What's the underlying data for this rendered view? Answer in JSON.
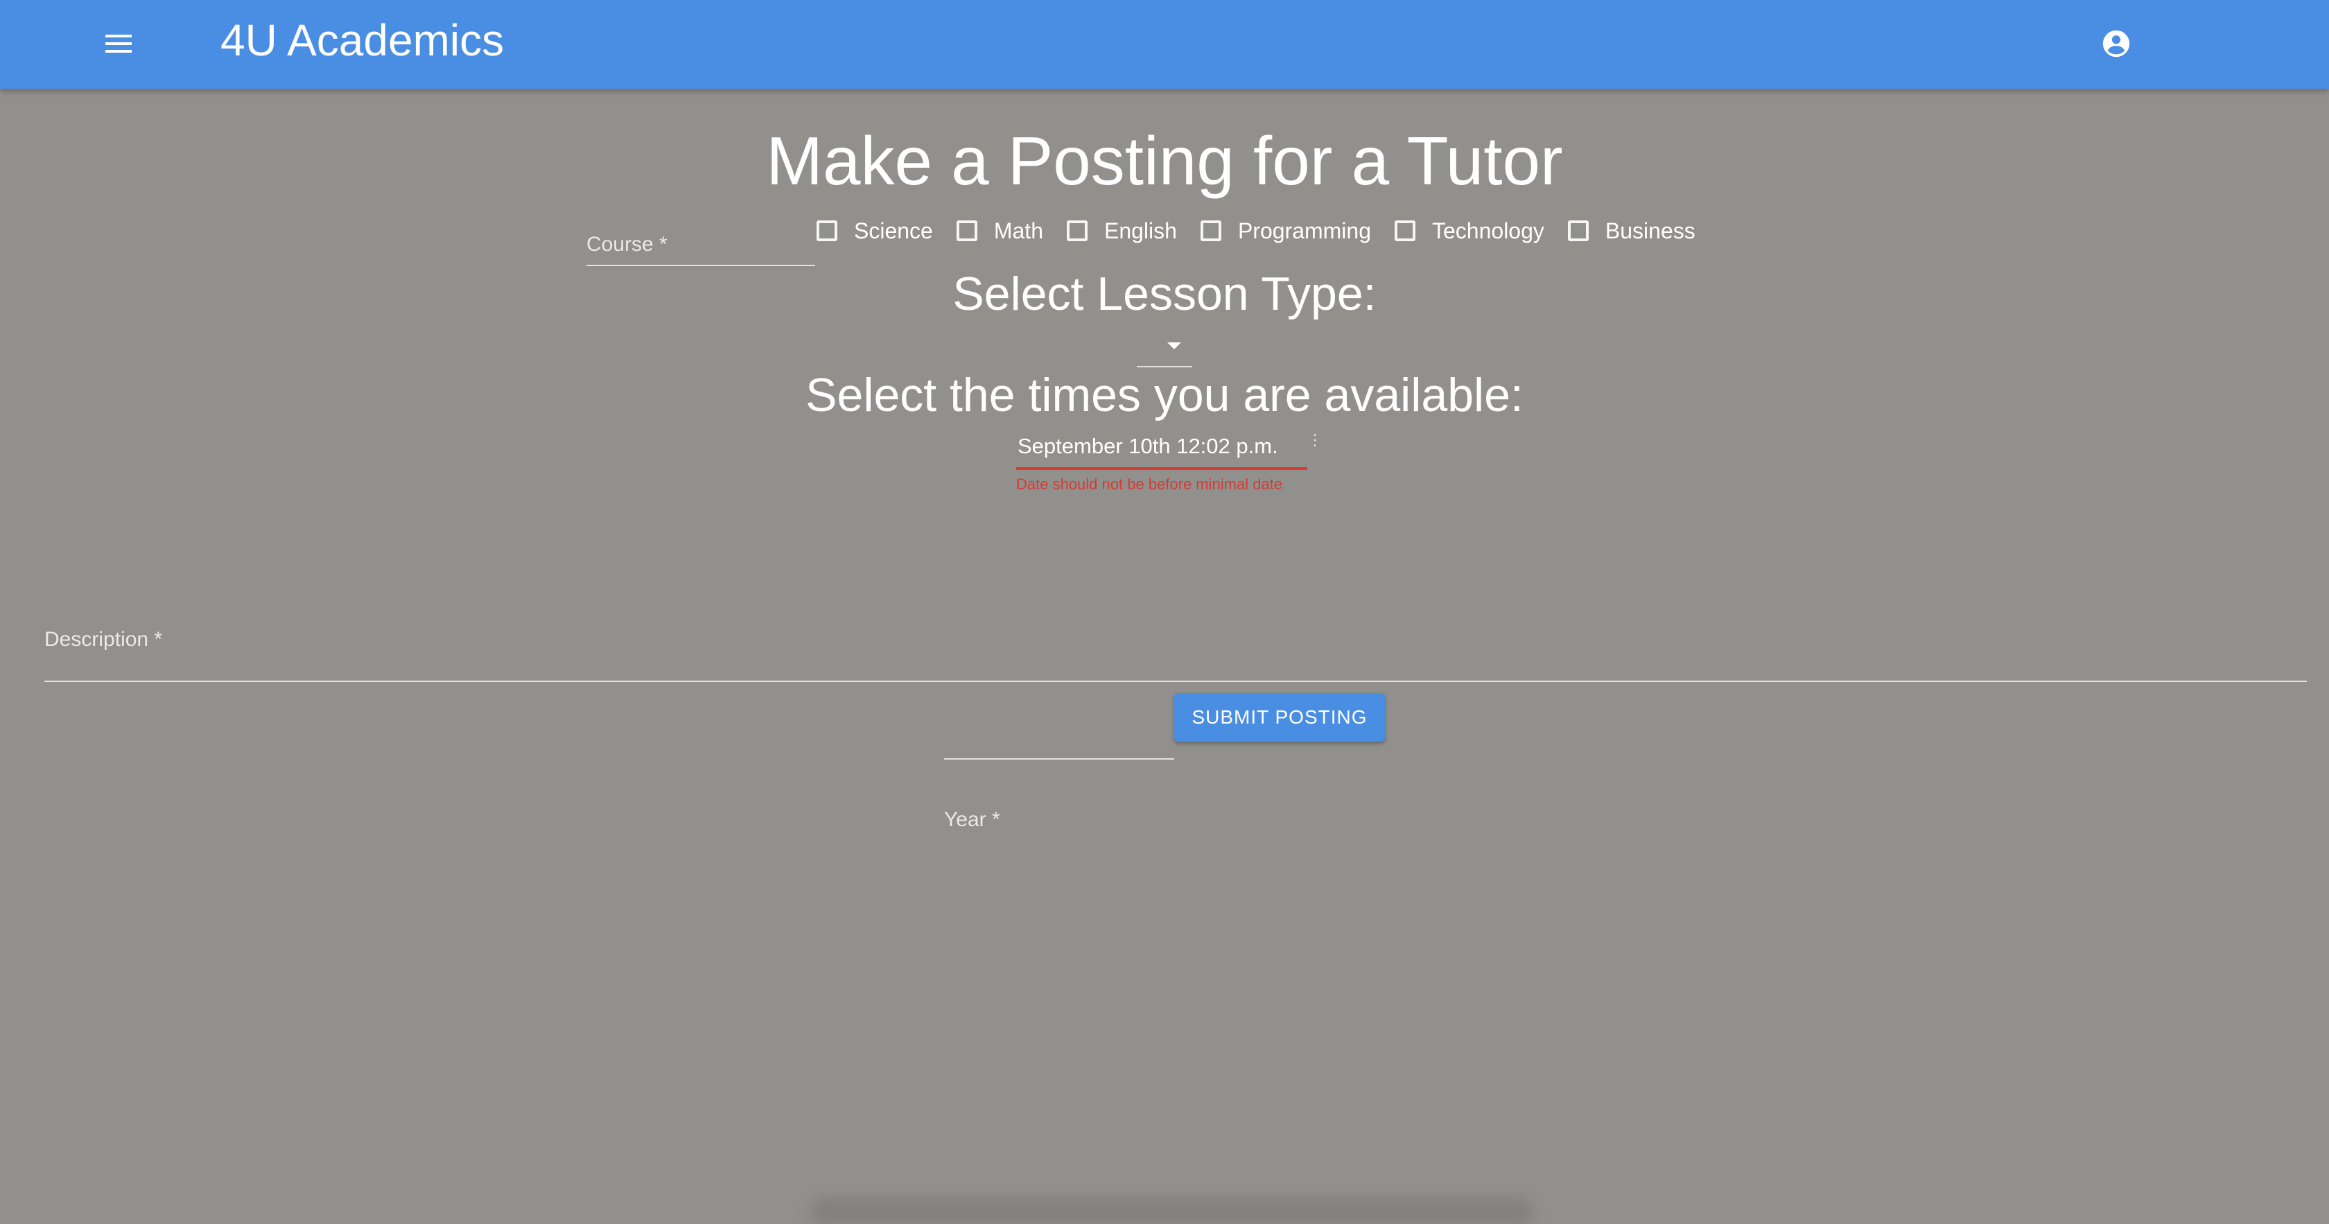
{
  "header": {
    "app_title": "4U Academics",
    "menu_icon": "hamburger-menu-icon",
    "account_icon": "account-circle-icon"
  },
  "form": {
    "title": "Make a Posting for a Tutor",
    "course": {
      "label": "Course *",
      "value": ""
    },
    "subjects": [
      {
        "label": "Science",
        "checked": false
      },
      {
        "label": "Math",
        "checked": false
      },
      {
        "label": "English",
        "checked": false
      },
      {
        "label": "Programming",
        "checked": false
      },
      {
        "label": "Technology",
        "checked": false
      },
      {
        "label": "Business",
        "checked": false
      }
    ],
    "lesson_type_heading": "Select Lesson Type:",
    "lesson_type_value": "",
    "times_heading": "Select the times you are available:",
    "date_value": "September 10th 12:02 p.m.",
    "date_error": "Date should not be before minimal date",
    "description": {
      "label": "Description *",
      "value": ""
    },
    "year": {
      "label": "Year *",
      "value": ""
    },
    "submit_label": "SUBMIT POSTING"
  },
  "colors": {
    "appbar": "#4a8ee3",
    "background": "#91908c",
    "error": "#d63b35",
    "text": "#ffffff"
  }
}
